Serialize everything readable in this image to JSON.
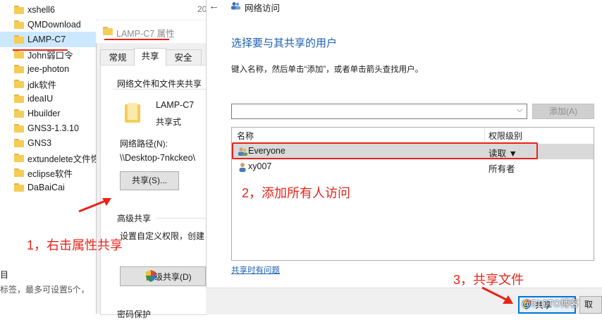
{
  "explorer": {
    "items": [
      {
        "label": "xshell6"
      },
      {
        "label": "QMDownload"
      },
      {
        "label": "LAMP-C7",
        "selected": true
      },
      {
        "label": "John弱口令"
      },
      {
        "label": "jee-photon"
      },
      {
        "label": "jdk软件"
      },
      {
        "label": "ideaIU"
      },
      {
        "label": "Hbuilder"
      },
      {
        "label": "GNS3-1.3.10"
      },
      {
        "label": "GNS3"
      },
      {
        "label": "extundelete文件恢"
      },
      {
        "label": "eclipse软件"
      },
      {
        "label": "DaBaiCai"
      }
    ],
    "date_partial": "20",
    "footer_label": "目",
    "footer_hint": "标签，最多可设置5个，"
  },
  "properties": {
    "title": "LAMP-C7 属性",
    "tabs": [
      {
        "label": "常规"
      },
      {
        "label": "共享",
        "active": true
      },
      {
        "label": "安全"
      }
    ],
    "section_network": "网络文件和文件夹共享",
    "folder_name": "LAMP-C7",
    "folder_status": "共享式",
    "path_label": "网络路径(N):",
    "path_value": "\\\\Desktop-7nkckeo\\",
    "share_button": "共享(S)...",
    "section_advanced": "高级共享",
    "advanced_desc": "设置自定义权限，创建",
    "advanced_button": "高级共享(D)",
    "section_password": "密码保护"
  },
  "network": {
    "title": "网络访问",
    "heading": "选择要与其共享的用户",
    "instruction": "键入名称，然后单击“添加”，或者单击箭头查找用户。",
    "input_value": "",
    "add_button": "添加(A)",
    "columns": {
      "name": "名称",
      "permission": "权限级别"
    },
    "users": [
      {
        "name": "Everyone",
        "permission": "读取 ▼",
        "selected": true
      },
      {
        "name": "xy007",
        "permission": "所有者"
      }
    ],
    "help_link": "共享时有问题",
    "share_button": "共享",
    "cancel_button": "取",
    "watermark": "@51CTO博客"
  },
  "annotations": {
    "step1": "1，右击属性共享",
    "step2": "2，添加所有人访问",
    "step3": "3，共享文件"
  },
  "colors": {
    "annotation": "#e8231a",
    "accent": "#0078d7",
    "heading": "#1a5fb4",
    "folder": "#f4cd57",
    "selection": "#cce8ff"
  }
}
